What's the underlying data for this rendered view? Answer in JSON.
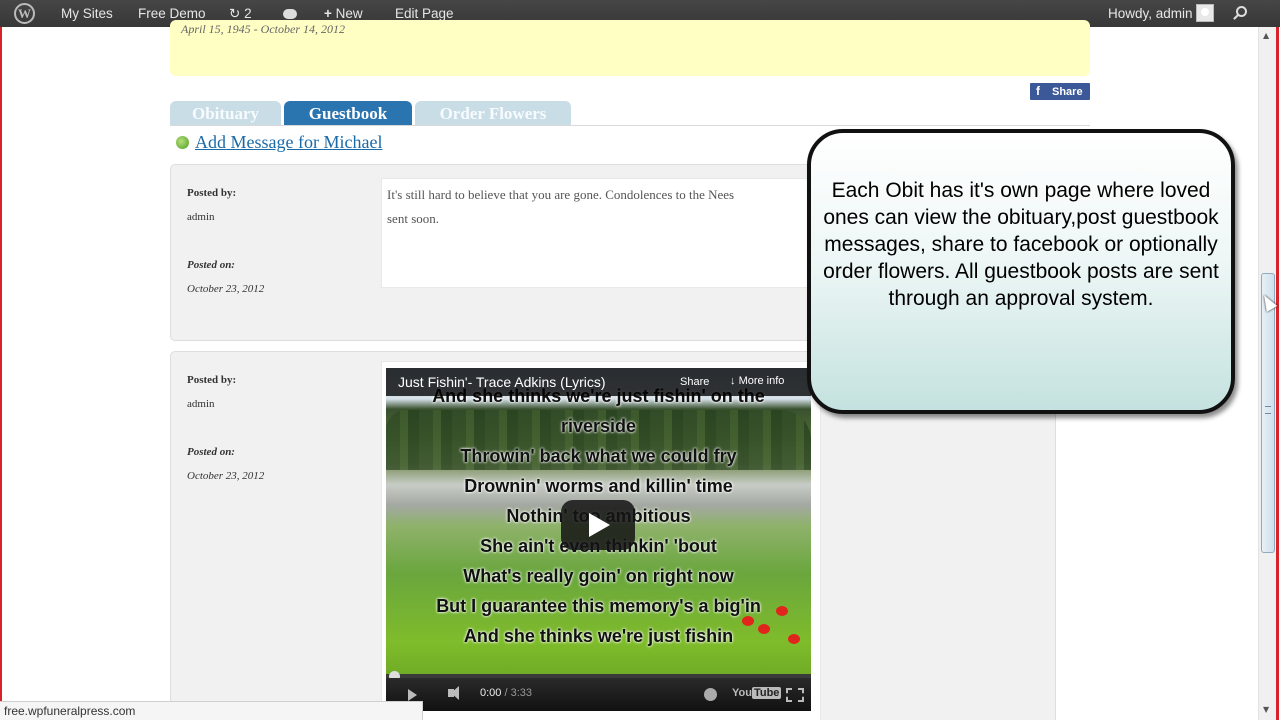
{
  "admin_bar": {
    "wp_logo": "W",
    "my_sites": "My Sites",
    "site_name": "Free Demo",
    "updates_count": "2",
    "new_label": "New",
    "edit_page": "Edit Page",
    "howdy": "Howdy, admin"
  },
  "header": {
    "dates": "April 15, 1945 - October 14, 2012",
    "facebook_share": "Share"
  },
  "tabs": {
    "obituary": "Obituary",
    "guestbook": "Guestbook",
    "order_flowers": "Order Flowers",
    "active": "Guestbook"
  },
  "guestbook": {
    "add_message": "Add Message for Michael",
    "posts": [
      {
        "posted_by_label": "Posted by:",
        "author": "admin",
        "posted_on_label": "Posted on:",
        "date": "October 23, 2012",
        "message": "It's still hard to believe that you are gone. Condolences to the Nees",
        "message_line2": "sent soon."
      },
      {
        "posted_by_label": "Posted by:",
        "author": "admin",
        "posted_on_label": "Posted on:",
        "date": "October 23, 2012"
      }
    ]
  },
  "video": {
    "title": "Just Fishin'- Trace Adkins (Lyrics)",
    "share": "Share",
    "more_info": "More info",
    "lyrics": [
      "And she thinks we're just fishin' on the",
      "riverside",
      "Throwin' back what we could fry",
      "Drownin' worms and killin' time",
      "Nothin' too ambitious",
      "She ain't even thinkin' 'bout",
      "What's really goin' on right now",
      "But I guarantee this memory's a big'in",
      "And she thinks we're just fishin"
    ],
    "current_time": "0:00",
    "duration": "/ 3:33",
    "youtube_label": "You",
    "youtube_tube": "Tube",
    "progress": 0
  },
  "callout": {
    "text": "Each Obit has it's own page where loved ones can view the obituary,post guestbook messages, share to facebook or optionally order flowers. All guestbook posts are sent through an approval system."
  },
  "status_bar": {
    "url": "free.wpfuneralpress.com"
  },
  "colors": {
    "admin_bar": "#464646",
    "tab_active": "#2a74b0",
    "tab_inactive": "#c9dde7",
    "link": "#1a6aa8",
    "facebook": "#3b5998",
    "highlight": "#ffffc4"
  }
}
